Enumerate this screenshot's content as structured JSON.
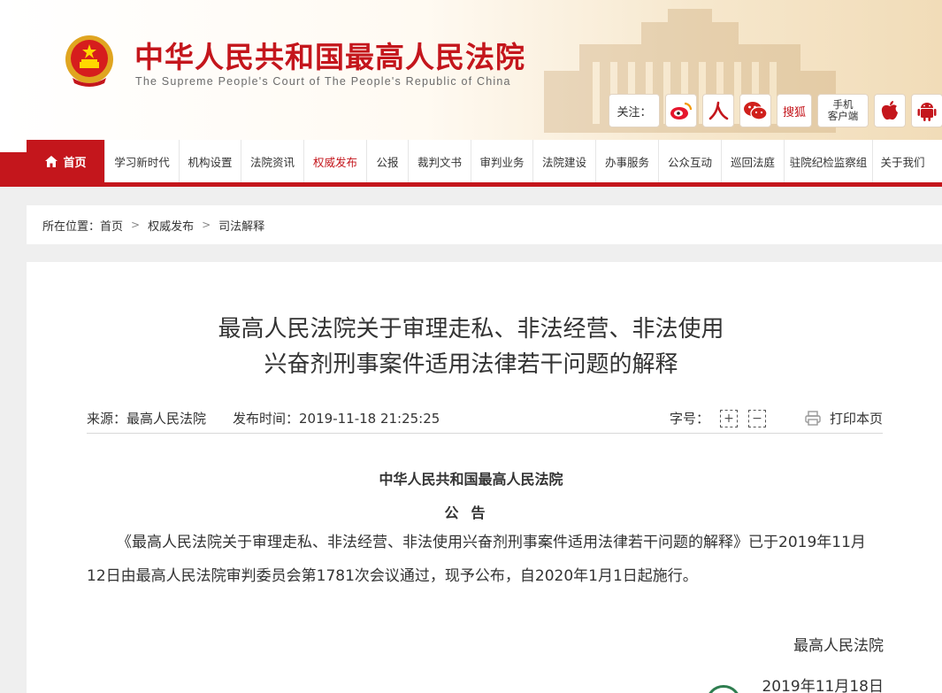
{
  "header": {
    "title": "中华人民共和国最高人民法院",
    "subtitle": "The Supreme People's Court of The People's Republic of China",
    "follow_label": "关注：",
    "sohu": "搜狐",
    "mobile_line1": "手机",
    "mobile_line2": "客户端",
    "icons": [
      "weibo-icon",
      "people-icon",
      "wechat-icon",
      "sohu-icon",
      "mobile-client-icon",
      "apple-icon",
      "android-icon"
    ]
  },
  "nav": {
    "home": "首页",
    "items": [
      "学习新时代",
      "机构设置",
      "法院资讯",
      "权威发布",
      "公报",
      "裁判文书",
      "审判业务",
      "法院建设",
      "办事服务",
      "公众互动",
      "巡回法庭",
      "驻院纪检监察组",
      "关于我们"
    ],
    "active": "权威发布"
  },
  "breadcrumb": {
    "prefix": "所在位置：",
    "items": [
      "首页",
      "权威发布",
      "司法解释"
    ]
  },
  "article": {
    "title_line1": "最高人民法院关于审理走私、非法经营、非法使用",
    "title_line2": "兴奋剂刑事案件适用法律若干问题的解释",
    "source": "来源：最高人民法院",
    "published": "发布时间：2019-11-18 21:25:25",
    "font_label": "字号：",
    "plus": "+",
    "minus": "−",
    "print": "打印本页",
    "court": "中华人民共和国最高人民法院",
    "notice": "公告",
    "body": "《最高人民法院关于审理走私、非法经营、非法使用兴奋剂刑事案件适用法律若干问题的解释》已于2019年11月12日由最高人民法院审判委员会第1781次会议通过，现予公布，自2020年1月1日起施行。",
    "signature": "最高人民法院",
    "date": "2019年11月18日"
  },
  "colors": {
    "brand_red": "#c4161c",
    "gold": "#f1dcb8"
  }
}
